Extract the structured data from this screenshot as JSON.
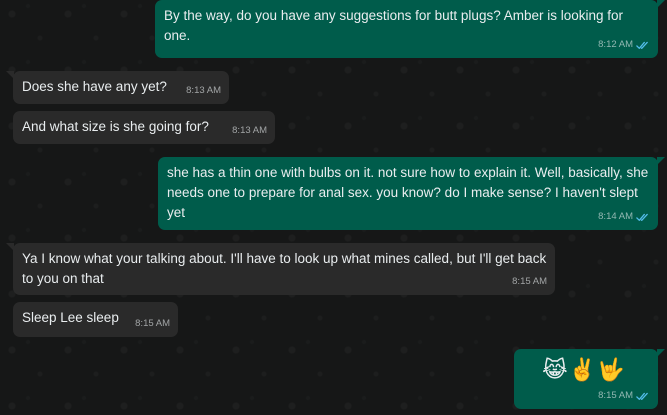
{
  "conversation": {
    "messages": [
      {
        "id": "m1",
        "direction": "outgoing",
        "text": "By the way, do you have any suggestions for butt plugs? Amber is looking for one.",
        "time": "8:12 AM",
        "status": "read"
      },
      {
        "id": "m2",
        "direction": "incoming",
        "text": "Does she have any yet?",
        "time": "8:13 AM"
      },
      {
        "id": "m3",
        "direction": "incoming",
        "text": "And what size is she going for?",
        "time": "8:13 AM"
      },
      {
        "id": "m4",
        "direction": "outgoing",
        "text": "she has a thin one with bulbs on it. not sure how to explain it. Well, basically, she needs one to prepare for anal sex. you know? do I make sense? I haven't slept yet",
        "time": "8:14 AM",
        "status": "read"
      },
      {
        "id": "m5",
        "direction": "incoming",
        "text": "Ya I know what your talking about. I'll have to look up what mines called, but I'll get back to you on that",
        "time": "8:15 AM"
      },
      {
        "id": "m6",
        "direction": "incoming",
        "text": "Sleep Lee sleep",
        "time": "8:15 AM"
      },
      {
        "id": "m7",
        "direction": "outgoing",
        "text": "😹✌️🤟",
        "time": "8:15 AM",
        "status": "read"
      }
    ]
  },
  "colors": {
    "background": "#161717",
    "outgoing_bubble": "#005c4b",
    "incoming_bubble": "#2a2a2a",
    "text": "#e9edef",
    "read_ticks": "#53bdeb"
  },
  "icons": {
    "read_receipt": "double-check-icon"
  }
}
